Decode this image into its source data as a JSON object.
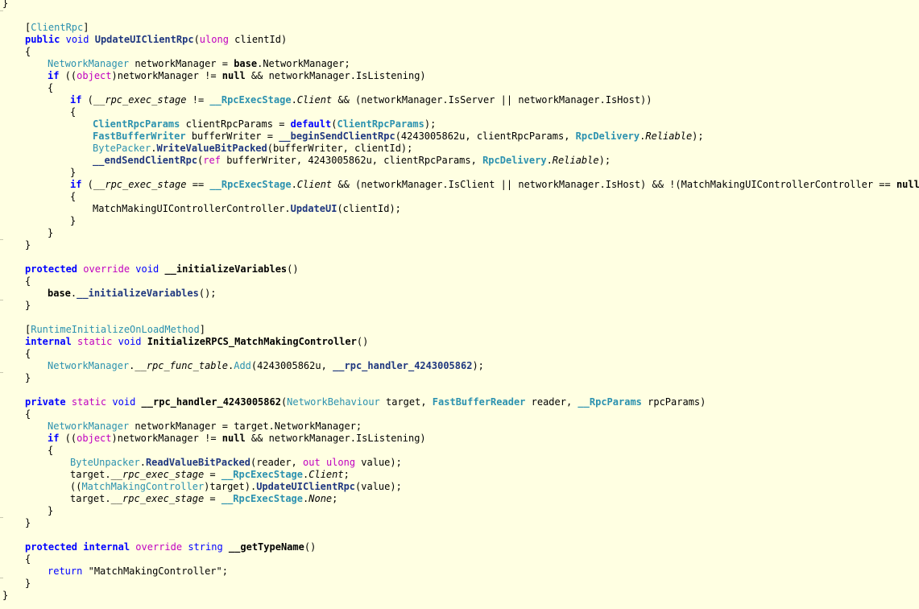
{
  "editor": {
    "background": "#ffffe2",
    "colors": {
      "keyword": "#0000ff",
      "type": "#2b91af",
      "method": "#1f377f",
      "modifier": "#c000c0",
      "plain": "#000000"
    },
    "lines": [
      {
        "indent": 0,
        "tokens": [
          {
            "k": "p",
            "t": "}"
          }
        ]
      },
      {
        "indent": 0,
        "tokens": []
      },
      {
        "indent": 1,
        "tokens": [
          {
            "k": "p",
            "t": "["
          },
          {
            "k": "ty",
            "t": "ClientRpc"
          },
          {
            "k": "p",
            "t": "]"
          }
        ]
      },
      {
        "indent": 1,
        "tokens": [
          {
            "k": "kwb",
            "t": "public"
          },
          {
            "k": "p",
            "t": " "
          },
          {
            "k": "kw",
            "t": "void"
          },
          {
            "k": "p",
            "t": " "
          },
          {
            "k": "mb",
            "t": "UpdateUIClientRpc"
          },
          {
            "k": "p",
            "t": "("
          },
          {
            "k": "mag",
            "t": "ulong"
          },
          {
            "k": "p",
            "t": " clientId)"
          }
        ]
      },
      {
        "indent": 1,
        "tokens": [
          {
            "k": "p",
            "t": "{"
          }
        ]
      },
      {
        "indent": 2,
        "tokens": [
          {
            "k": "ty",
            "t": "NetworkManager"
          },
          {
            "k": "p",
            "t": " networkManager = "
          },
          {
            "k": "b",
            "t": "base"
          },
          {
            "k": "p",
            "t": ".NetworkManager;"
          }
        ]
      },
      {
        "indent": 2,
        "tokens": [
          {
            "k": "kwb",
            "t": "if"
          },
          {
            "k": "p",
            "t": " (("
          },
          {
            "k": "mag",
            "t": "object"
          },
          {
            "k": "p",
            "t": ")networkManager != "
          },
          {
            "k": "b",
            "t": "null"
          },
          {
            "k": "p",
            "t": " && networkManager.IsListening)"
          }
        ]
      },
      {
        "indent": 2,
        "tokens": [
          {
            "k": "p",
            "t": "{"
          }
        ]
      },
      {
        "indent": 3,
        "tokens": [
          {
            "k": "kwb",
            "t": "if"
          },
          {
            "k": "p",
            "t": " ("
          },
          {
            "k": "it",
            "t": "__rpc_exec_stage"
          },
          {
            "k": "p",
            "t": " != "
          },
          {
            "k": "tyb",
            "t": "__RpcExecStage"
          },
          {
            "k": "p",
            "t": "."
          },
          {
            "k": "it",
            "t": "Client"
          },
          {
            "k": "p",
            "t": " && (networkManager.IsServer || networkManager.IsHost))"
          }
        ]
      },
      {
        "indent": 3,
        "tokens": [
          {
            "k": "p",
            "t": "{"
          }
        ]
      },
      {
        "indent": 4,
        "tokens": [
          {
            "k": "tyb",
            "t": "ClientRpcParams"
          },
          {
            "k": "p",
            "t": " clientRpcParams = "
          },
          {
            "k": "kwb",
            "t": "default"
          },
          {
            "k": "p",
            "t": "("
          },
          {
            "k": "tyb",
            "t": "ClientRpcParams"
          },
          {
            "k": "p",
            "t": ");"
          }
        ]
      },
      {
        "indent": 4,
        "tokens": [
          {
            "k": "tyb",
            "t": "FastBufferWriter"
          },
          {
            "k": "p",
            "t": " bufferWriter = "
          },
          {
            "k": "mb",
            "t": "__beginSendClientRpc"
          },
          {
            "k": "p",
            "t": "(4243005862u, clientRpcParams, "
          },
          {
            "k": "tyb",
            "t": "RpcDelivery"
          },
          {
            "k": "p",
            "t": "."
          },
          {
            "k": "it",
            "t": "Reliable"
          },
          {
            "k": "p",
            "t": ");"
          }
        ]
      },
      {
        "indent": 4,
        "tokens": [
          {
            "k": "ty",
            "t": "BytePacker"
          },
          {
            "k": "p",
            "t": "."
          },
          {
            "k": "mb",
            "t": "WriteValueBitPacked"
          },
          {
            "k": "p",
            "t": "(bufferWriter, clientId);"
          }
        ]
      },
      {
        "indent": 4,
        "tokens": [
          {
            "k": "mb",
            "t": "__endSendClientRpc"
          },
          {
            "k": "p",
            "t": "("
          },
          {
            "k": "mag",
            "t": "ref"
          },
          {
            "k": "p",
            "t": " bufferWriter, 4243005862u, clientRpcParams, "
          },
          {
            "k": "tyb",
            "t": "RpcDelivery"
          },
          {
            "k": "p",
            "t": "."
          },
          {
            "k": "it",
            "t": "Reliable"
          },
          {
            "k": "p",
            "t": ");"
          }
        ]
      },
      {
        "indent": 3,
        "tokens": [
          {
            "k": "p",
            "t": "}"
          }
        ]
      },
      {
        "indent": 3,
        "tokens": [
          {
            "k": "kwb",
            "t": "if"
          },
          {
            "k": "p",
            "t": " ("
          },
          {
            "k": "it",
            "t": "__rpc_exec_stage"
          },
          {
            "k": "p",
            "t": " == "
          },
          {
            "k": "tyb",
            "t": "__RpcExecStage"
          },
          {
            "k": "p",
            "t": "."
          },
          {
            "k": "it",
            "t": "Client"
          },
          {
            "k": "p",
            "t": " && (networkManager.IsClient || networkManager.IsHost) && !(MatchMakingUIControllerController == "
          },
          {
            "k": "b",
            "t": "null"
          },
          {
            "k": "p",
            "t": "))"
          }
        ]
      },
      {
        "indent": 3,
        "tokens": [
          {
            "k": "p",
            "t": "{"
          }
        ]
      },
      {
        "indent": 4,
        "tokens": [
          {
            "k": "p",
            "t": "MatchMakingUIControllerController."
          },
          {
            "k": "mb",
            "t": "UpdateUI"
          },
          {
            "k": "p",
            "t": "(clientId);"
          }
        ]
      },
      {
        "indent": 3,
        "tokens": [
          {
            "k": "p",
            "t": "}"
          }
        ]
      },
      {
        "indent": 2,
        "tokens": [
          {
            "k": "p",
            "t": "}"
          }
        ]
      },
      {
        "indent": 1,
        "tokens": [
          {
            "k": "p",
            "t": "}"
          }
        ]
      },
      {
        "indent": 0,
        "tokens": []
      },
      {
        "indent": 1,
        "tokens": [
          {
            "k": "kwb",
            "t": "protected"
          },
          {
            "k": "p",
            "t": " "
          },
          {
            "k": "mag",
            "t": "override"
          },
          {
            "k": "p",
            "t": " "
          },
          {
            "k": "kw",
            "t": "void"
          },
          {
            "k": "p",
            "t": " "
          },
          {
            "k": "b",
            "t": "__initializeVariables"
          },
          {
            "k": "p",
            "t": "()"
          }
        ]
      },
      {
        "indent": 1,
        "tokens": [
          {
            "k": "p",
            "t": "{"
          }
        ]
      },
      {
        "indent": 2,
        "tokens": [
          {
            "k": "b",
            "t": "base"
          },
          {
            "k": "p",
            "t": "."
          },
          {
            "k": "mb",
            "t": "__initializeVariables"
          },
          {
            "k": "p",
            "t": "();"
          }
        ]
      },
      {
        "indent": 1,
        "tokens": [
          {
            "k": "p",
            "t": "}"
          }
        ]
      },
      {
        "indent": 0,
        "tokens": []
      },
      {
        "indent": 1,
        "tokens": [
          {
            "k": "p",
            "t": "["
          },
          {
            "k": "ty",
            "t": "RuntimeInitializeOnLoadMethod"
          },
          {
            "k": "p",
            "t": "]"
          }
        ]
      },
      {
        "indent": 1,
        "tokens": [
          {
            "k": "kwb",
            "t": "internal"
          },
          {
            "k": "p",
            "t": " "
          },
          {
            "k": "mag",
            "t": "static"
          },
          {
            "k": "p",
            "t": " "
          },
          {
            "k": "kw",
            "t": "void"
          },
          {
            "k": "p",
            "t": " "
          },
          {
            "k": "b",
            "t": "InitializeRPCS_MatchMakingController"
          },
          {
            "k": "p",
            "t": "()"
          }
        ]
      },
      {
        "indent": 1,
        "tokens": [
          {
            "k": "p",
            "t": "{"
          }
        ]
      },
      {
        "indent": 2,
        "tokens": [
          {
            "k": "ty",
            "t": "NetworkManager"
          },
          {
            "k": "p",
            "t": "."
          },
          {
            "k": "it",
            "t": "__rpc_func_table"
          },
          {
            "k": "p",
            "t": "."
          },
          {
            "k": "ty",
            "t": "Add"
          },
          {
            "k": "p",
            "t": "(4243005862u, "
          },
          {
            "k": "mb",
            "t": "__rpc_handler_4243005862"
          },
          {
            "k": "p",
            "t": ");"
          }
        ]
      },
      {
        "indent": 1,
        "tokens": [
          {
            "k": "p",
            "t": "}"
          }
        ]
      },
      {
        "indent": 0,
        "tokens": []
      },
      {
        "indent": 1,
        "tokens": [
          {
            "k": "kwb",
            "t": "private"
          },
          {
            "k": "p",
            "t": " "
          },
          {
            "k": "mag",
            "t": "static"
          },
          {
            "k": "p",
            "t": " "
          },
          {
            "k": "kw",
            "t": "void"
          },
          {
            "k": "p",
            "t": " "
          },
          {
            "k": "b",
            "t": "__rpc_handler_4243005862"
          },
          {
            "k": "p",
            "t": "("
          },
          {
            "k": "ty",
            "t": "NetworkBehaviour"
          },
          {
            "k": "p",
            "t": " target, "
          },
          {
            "k": "tyb",
            "t": "FastBufferReader"
          },
          {
            "k": "p",
            "t": " reader, "
          },
          {
            "k": "tyb",
            "t": "__RpcParams"
          },
          {
            "k": "p",
            "t": " rpcParams)"
          }
        ]
      },
      {
        "indent": 1,
        "tokens": [
          {
            "k": "p",
            "t": "{"
          }
        ]
      },
      {
        "indent": 2,
        "tokens": [
          {
            "k": "ty",
            "t": "NetworkManager"
          },
          {
            "k": "p",
            "t": " networkManager = target.NetworkManager;"
          }
        ]
      },
      {
        "indent": 2,
        "tokens": [
          {
            "k": "kwb",
            "t": "if"
          },
          {
            "k": "p",
            "t": " (("
          },
          {
            "k": "mag",
            "t": "object"
          },
          {
            "k": "p",
            "t": ")networkManager != "
          },
          {
            "k": "b",
            "t": "null"
          },
          {
            "k": "p",
            "t": " && networkManager.IsListening)"
          }
        ]
      },
      {
        "indent": 2,
        "tokens": [
          {
            "k": "p",
            "t": "{"
          }
        ]
      },
      {
        "indent": 3,
        "tokens": [
          {
            "k": "ty",
            "t": "ByteUnpacker"
          },
          {
            "k": "p",
            "t": "."
          },
          {
            "k": "mb",
            "t": "ReadValueBitPacked"
          },
          {
            "k": "p",
            "t": "(reader, "
          },
          {
            "k": "mag",
            "t": "out"
          },
          {
            "k": "p",
            "t": " "
          },
          {
            "k": "mag",
            "t": "ulong"
          },
          {
            "k": "p",
            "t": " value);"
          }
        ]
      },
      {
        "indent": 3,
        "tokens": [
          {
            "k": "p",
            "t": "target."
          },
          {
            "k": "it",
            "t": "__rpc_exec_stage"
          },
          {
            "k": "p",
            "t": " = "
          },
          {
            "k": "tyb",
            "t": "__RpcExecStage"
          },
          {
            "k": "p",
            "t": "."
          },
          {
            "k": "it",
            "t": "Client"
          },
          {
            "k": "p",
            "t": ";"
          }
        ]
      },
      {
        "indent": 3,
        "tokens": [
          {
            "k": "p",
            "t": "(("
          },
          {
            "k": "ty",
            "t": "MatchMakingController"
          },
          {
            "k": "p",
            "t": ")target)."
          },
          {
            "k": "mb",
            "t": "UpdateUIClientRpc"
          },
          {
            "k": "p",
            "t": "(value);"
          }
        ]
      },
      {
        "indent": 3,
        "tokens": [
          {
            "k": "p",
            "t": "target."
          },
          {
            "k": "it",
            "t": "__rpc_exec_stage"
          },
          {
            "k": "p",
            "t": " = "
          },
          {
            "k": "tyb",
            "t": "__RpcExecStage"
          },
          {
            "k": "p",
            "t": "."
          },
          {
            "k": "it",
            "t": "None"
          },
          {
            "k": "p",
            "t": ";"
          }
        ]
      },
      {
        "indent": 2,
        "tokens": [
          {
            "k": "p",
            "t": "}"
          }
        ]
      },
      {
        "indent": 1,
        "tokens": [
          {
            "k": "p",
            "t": "}"
          }
        ]
      },
      {
        "indent": 0,
        "tokens": []
      },
      {
        "indent": 1,
        "tokens": [
          {
            "k": "kwb",
            "t": "protected"
          },
          {
            "k": "p",
            "t": " "
          },
          {
            "k": "kwb",
            "t": "internal"
          },
          {
            "k": "p",
            "t": " "
          },
          {
            "k": "mag",
            "t": "override"
          },
          {
            "k": "p",
            "t": " "
          },
          {
            "k": "kw",
            "t": "string"
          },
          {
            "k": "p",
            "t": " "
          },
          {
            "k": "b",
            "t": "__getTypeName"
          },
          {
            "k": "p",
            "t": "()"
          }
        ]
      },
      {
        "indent": 1,
        "tokens": [
          {
            "k": "p",
            "t": "{"
          }
        ]
      },
      {
        "indent": 2,
        "tokens": [
          {
            "k": "kw",
            "t": "return"
          },
          {
            "k": "p",
            "t": " "
          },
          {
            "k": "str",
            "t": "\"MatchMakingController\""
          },
          {
            "k": "p",
            "t": ";"
          }
        ]
      },
      {
        "indent": 1,
        "tokens": [
          {
            "k": "p",
            "t": "}"
          }
        ]
      },
      {
        "indent": 0,
        "tokens": [
          {
            "k": "p",
            "t": "}"
          }
        ]
      }
    ]
  }
}
